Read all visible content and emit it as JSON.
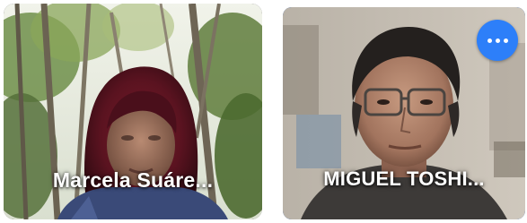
{
  "participants": [
    {
      "name": "Marcela Suáre...",
      "highlighted": false
    },
    {
      "name": "MIGUEL TOSHI...",
      "highlighted": true,
      "more_options_icon": "more-horizontal-icon"
    }
  ],
  "colors": {
    "highlight_border": "#4a86e8",
    "more_button": "#2d7ff9",
    "name_text": "#ffffff"
  }
}
